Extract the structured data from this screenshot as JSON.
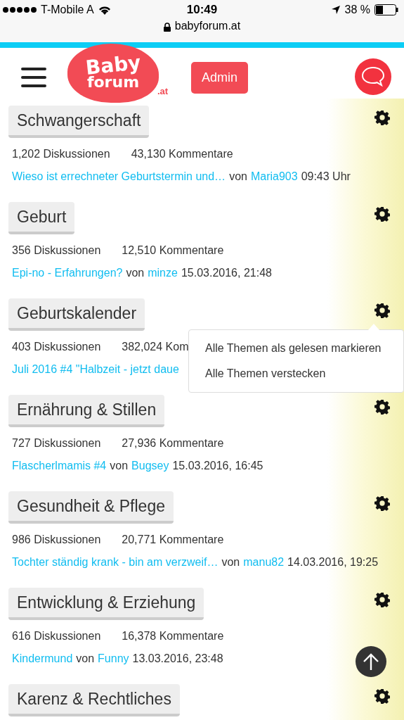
{
  "status_bar": {
    "carrier": "T-Mobile A",
    "time": "10:49",
    "battery": "38 %"
  },
  "url_bar": {
    "url": "babyforum.at"
  },
  "header": {
    "logo": {
      "line1": "Baby",
      "line2": "forum",
      "suffix": ".at"
    },
    "admin_button": "Admin"
  },
  "categories": [
    {
      "title": "Schwangerschaft",
      "discussions": "1,202 Diskussionen",
      "comments": "43,130 Kommentare",
      "last_post": "Wieso ist errechneter Geburtstermin und…",
      "by": "von",
      "author": "Maria903",
      "date": "09:43 Uhr"
    },
    {
      "title": "Geburt",
      "discussions": "356 Diskussionen",
      "comments": "12,510 Kommentare",
      "last_post": "Epi-no - Erfahrungen?",
      "by": "von",
      "author": "minze",
      "date": "15.03.2016, 21:48"
    },
    {
      "title": "Geburtskalender",
      "discussions": "403 Diskussionen",
      "comments": "382,024 Kom",
      "last_post": "Juli 2016 #4 \"Halbzeit - jetzt daue",
      "gear_menu": {
        "items": [
          "Alle Themen als gelesen markieren",
          "Alle Themen verstecken"
        ]
      }
    },
    {
      "title": "Ernährung & Stillen",
      "discussions": "727 Diskussionen",
      "comments": "27,936 Kommentare",
      "last_post": "Flascherlmamis #4",
      "by": "von",
      "author": "Bugsey",
      "date": "15.03.2016, 16:45"
    },
    {
      "title": "Gesundheit & Pflege",
      "discussions": "986 Diskussionen",
      "comments": "20,771 Kommentare",
      "last_post": "Tochter ständig krank - bin am verzweif…",
      "by": "von",
      "author": "manu82",
      "date": "14.03.2016, 19:25"
    },
    {
      "title": "Entwicklung & Erziehung",
      "discussions": "616 Diskussionen",
      "comments": "16,378 Kommentare",
      "last_post": "Kindermund",
      "by": "von",
      "author": "Funny",
      "date": "13.03.2016, 23:48"
    },
    {
      "title": "Karenz & Rechtliches"
    }
  ]
}
